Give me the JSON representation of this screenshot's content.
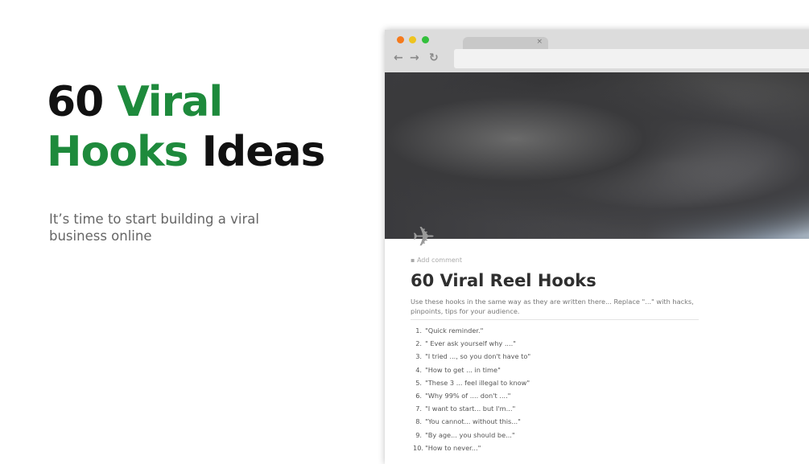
{
  "hero": {
    "line1_black": "60 ",
    "line1_green": "Viral",
    "line2_green": "Hooks",
    "line2_black": " Ideas"
  },
  "subtitle": "It’s time to start building a viral business online",
  "browser": {
    "tab_close": "×",
    "back": "←",
    "forward": "→",
    "reload": "↻"
  },
  "page": {
    "add_comment": "Add comment",
    "title": "60 Viral Reel Hooks",
    "description": "Use these hooks in the same way as they are written there... Replace \"...\" with hacks, pinpoints, tips for your audience.",
    "hooks": [
      {
        "n": "1.",
        "t": "\"Quick reminder.\""
      },
      {
        "n": "2.",
        "t": "\" Ever ask yourself why ....\""
      },
      {
        "n": "3.",
        "t": "\"I tried ..., so you don't have to\""
      },
      {
        "n": "4.",
        "t": "\"How to get ... in time\""
      },
      {
        "n": "5.",
        "t": "\"These 3 ... feel illegal to know\""
      },
      {
        "n": "6.",
        "t": "\"Why 99% of .... don't ....\""
      },
      {
        "n": "7.",
        "t": "\"I want to start... but I'm...\""
      },
      {
        "n": "8.",
        "t": "\"You cannot... without this...\""
      },
      {
        "n": "9.",
        "t": "\"By age... you should be...\""
      },
      {
        "n": "10.",
        "t": "\"How to never...\""
      }
    ]
  }
}
